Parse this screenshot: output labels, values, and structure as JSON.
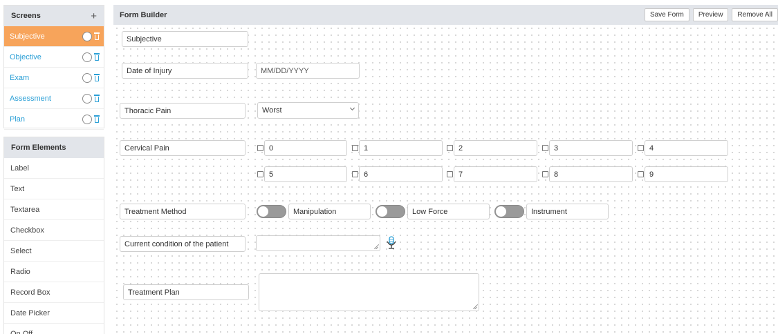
{
  "sidebar": {
    "screens_title": "Screens",
    "add_symbol": "+",
    "screens": [
      {
        "label": "Subjective",
        "active": true
      },
      {
        "label": "Objective",
        "active": false
      },
      {
        "label": "Exam",
        "active": false
      },
      {
        "label": "Assessment",
        "active": false
      },
      {
        "label": "Plan",
        "active": false
      }
    ],
    "elements_title": "Form Elements",
    "elements": [
      "Label",
      "Text",
      "Textarea",
      "Checkbox",
      "Select",
      "Radio",
      "Record Box",
      "Date Picker",
      "On Off"
    ]
  },
  "header": {
    "title": "Form Builder",
    "save_label": "Save Form",
    "preview_label": "Preview",
    "remove_label": "Remove All"
  },
  "form": {
    "subjective_label": "Subjective",
    "date_label": "Date of Injury",
    "date_placeholder": "MM/DD/YYYY",
    "thoracic_label": "Thoracic Pain",
    "thoracic_value": "Worst",
    "cervical_label": "Cervical Pain",
    "cervical_options": [
      "0",
      "1",
      "2",
      "3",
      "4",
      "5",
      "6",
      "7",
      "8",
      "9"
    ],
    "treatment_method_label": "Treatment Method",
    "toggles": [
      "Manipulation",
      "Low Force",
      "Instrument"
    ],
    "condition_label": "Current condition of the patient",
    "treatment_plan_label": "Treatment Plan"
  },
  "colors": {
    "active_screen": "#f7a45b",
    "link": "#2a9fd6",
    "header_bg": "#e2e5ea"
  },
  "icons": [
    "plus-icon",
    "radio-circle-icon",
    "trash-icon",
    "microphone-icon",
    "chevron-down-icon",
    "resize-handle-icon"
  ]
}
